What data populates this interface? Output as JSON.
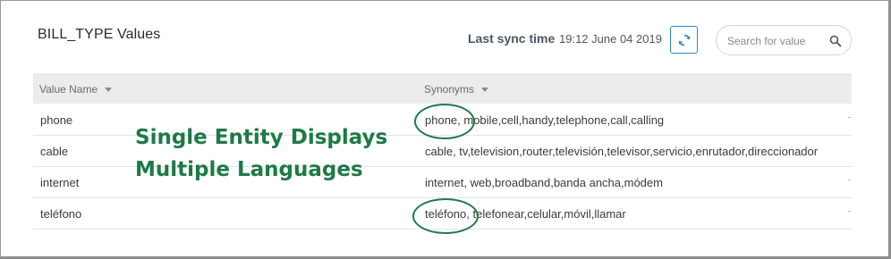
{
  "header": {
    "title": "BILL_TYPE Values",
    "sync_label": "Last sync time",
    "sync_time": "19:12 June 04 2019",
    "search_placeholder": "Search for value"
  },
  "table": {
    "columns": [
      "Value Name",
      "Synonyms"
    ],
    "rows": [
      {
        "name": "phone",
        "synonyms": "phone, mobile,cell,handy,telephone,call,calling"
      },
      {
        "name": "cable",
        "synonyms": "cable, tv,television,router,televisión,televisor,servicio,enrutador,direccionador"
      },
      {
        "name": "internet",
        "synonyms": "internet, web,broadband,banda ancha,módem"
      },
      {
        "name": "teléfono",
        "synonyms": "teléfono, telefonear,celular,móvil,llamar"
      }
    ]
  },
  "annotation": {
    "line1": "Single Entity Displays",
    "line2": "Multiple Languages"
  },
  "colors": {
    "annotation": "#1d7a46",
    "accent": "#2a8ac8"
  },
  "icons": {
    "refresh": "refresh-icon",
    "search": "search-icon",
    "sort": "sort-caret-icon"
  }
}
